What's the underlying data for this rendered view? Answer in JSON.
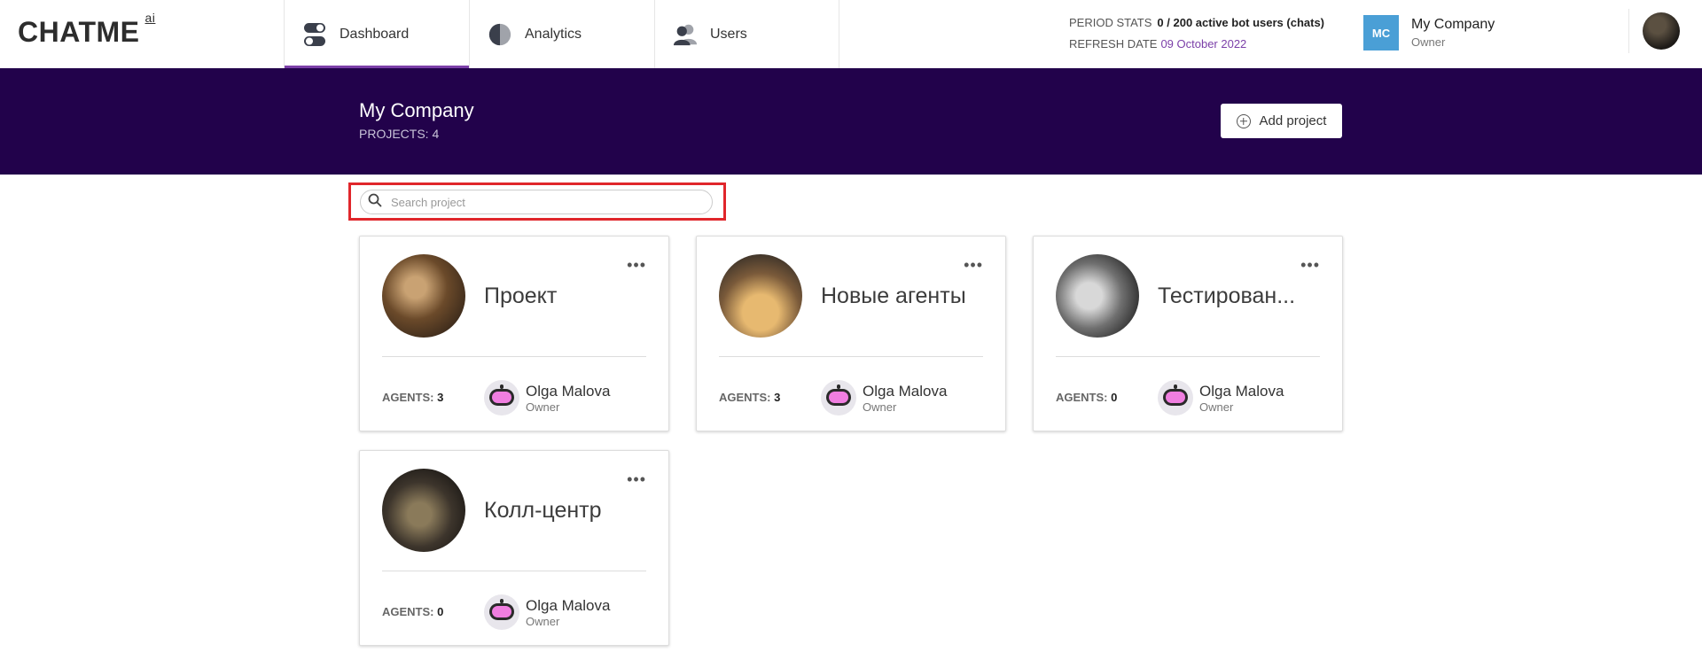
{
  "app": {
    "logo": "CHATME",
    "logo_sup": "ai"
  },
  "nav": {
    "tabs": [
      {
        "label": "Dashboard",
        "icon": "toggle-icon",
        "active": true
      },
      {
        "label": "Analytics",
        "icon": "pie-chart-icon",
        "active": false
      },
      {
        "label": "Users",
        "icon": "users-icon",
        "active": false
      }
    ]
  },
  "stats": {
    "period_label": "PERIOD STATS",
    "period_value": "0 / 200 active bot users (chats)",
    "refresh_label": "REFRESH DATE",
    "refresh_value": "09 October 2022"
  },
  "company": {
    "badge": "MC",
    "name": "My Company",
    "role": "Owner"
  },
  "banner": {
    "title": "My Company",
    "projects_label": "PROJECTS:",
    "projects_count": "4",
    "add_button": "Add project"
  },
  "search": {
    "placeholder": "Search project",
    "value": ""
  },
  "colors": {
    "brand": "#22024b",
    "accent": "#7b3fa8",
    "highlight": "#e0262b",
    "badge": "#4a9fd6"
  },
  "projects": [
    {
      "name": "Проект",
      "agents_label": "AGENTS:",
      "agents": "3",
      "owner": "Olga Malova",
      "owner_role": "Owner"
    },
    {
      "name": "Новые агенты",
      "agents_label": "AGENTS:",
      "agents": "3",
      "owner": "Olga Malova",
      "owner_role": "Owner"
    },
    {
      "name": "Тестирован...",
      "agents_label": "AGENTS:",
      "agents": "0",
      "owner": "Olga Malova",
      "owner_role": "Owner"
    },
    {
      "name": "Колл-центр",
      "agents_label": "AGENTS:",
      "agents": "0",
      "owner": "Olga Malova",
      "owner_role": "Owner"
    }
  ]
}
